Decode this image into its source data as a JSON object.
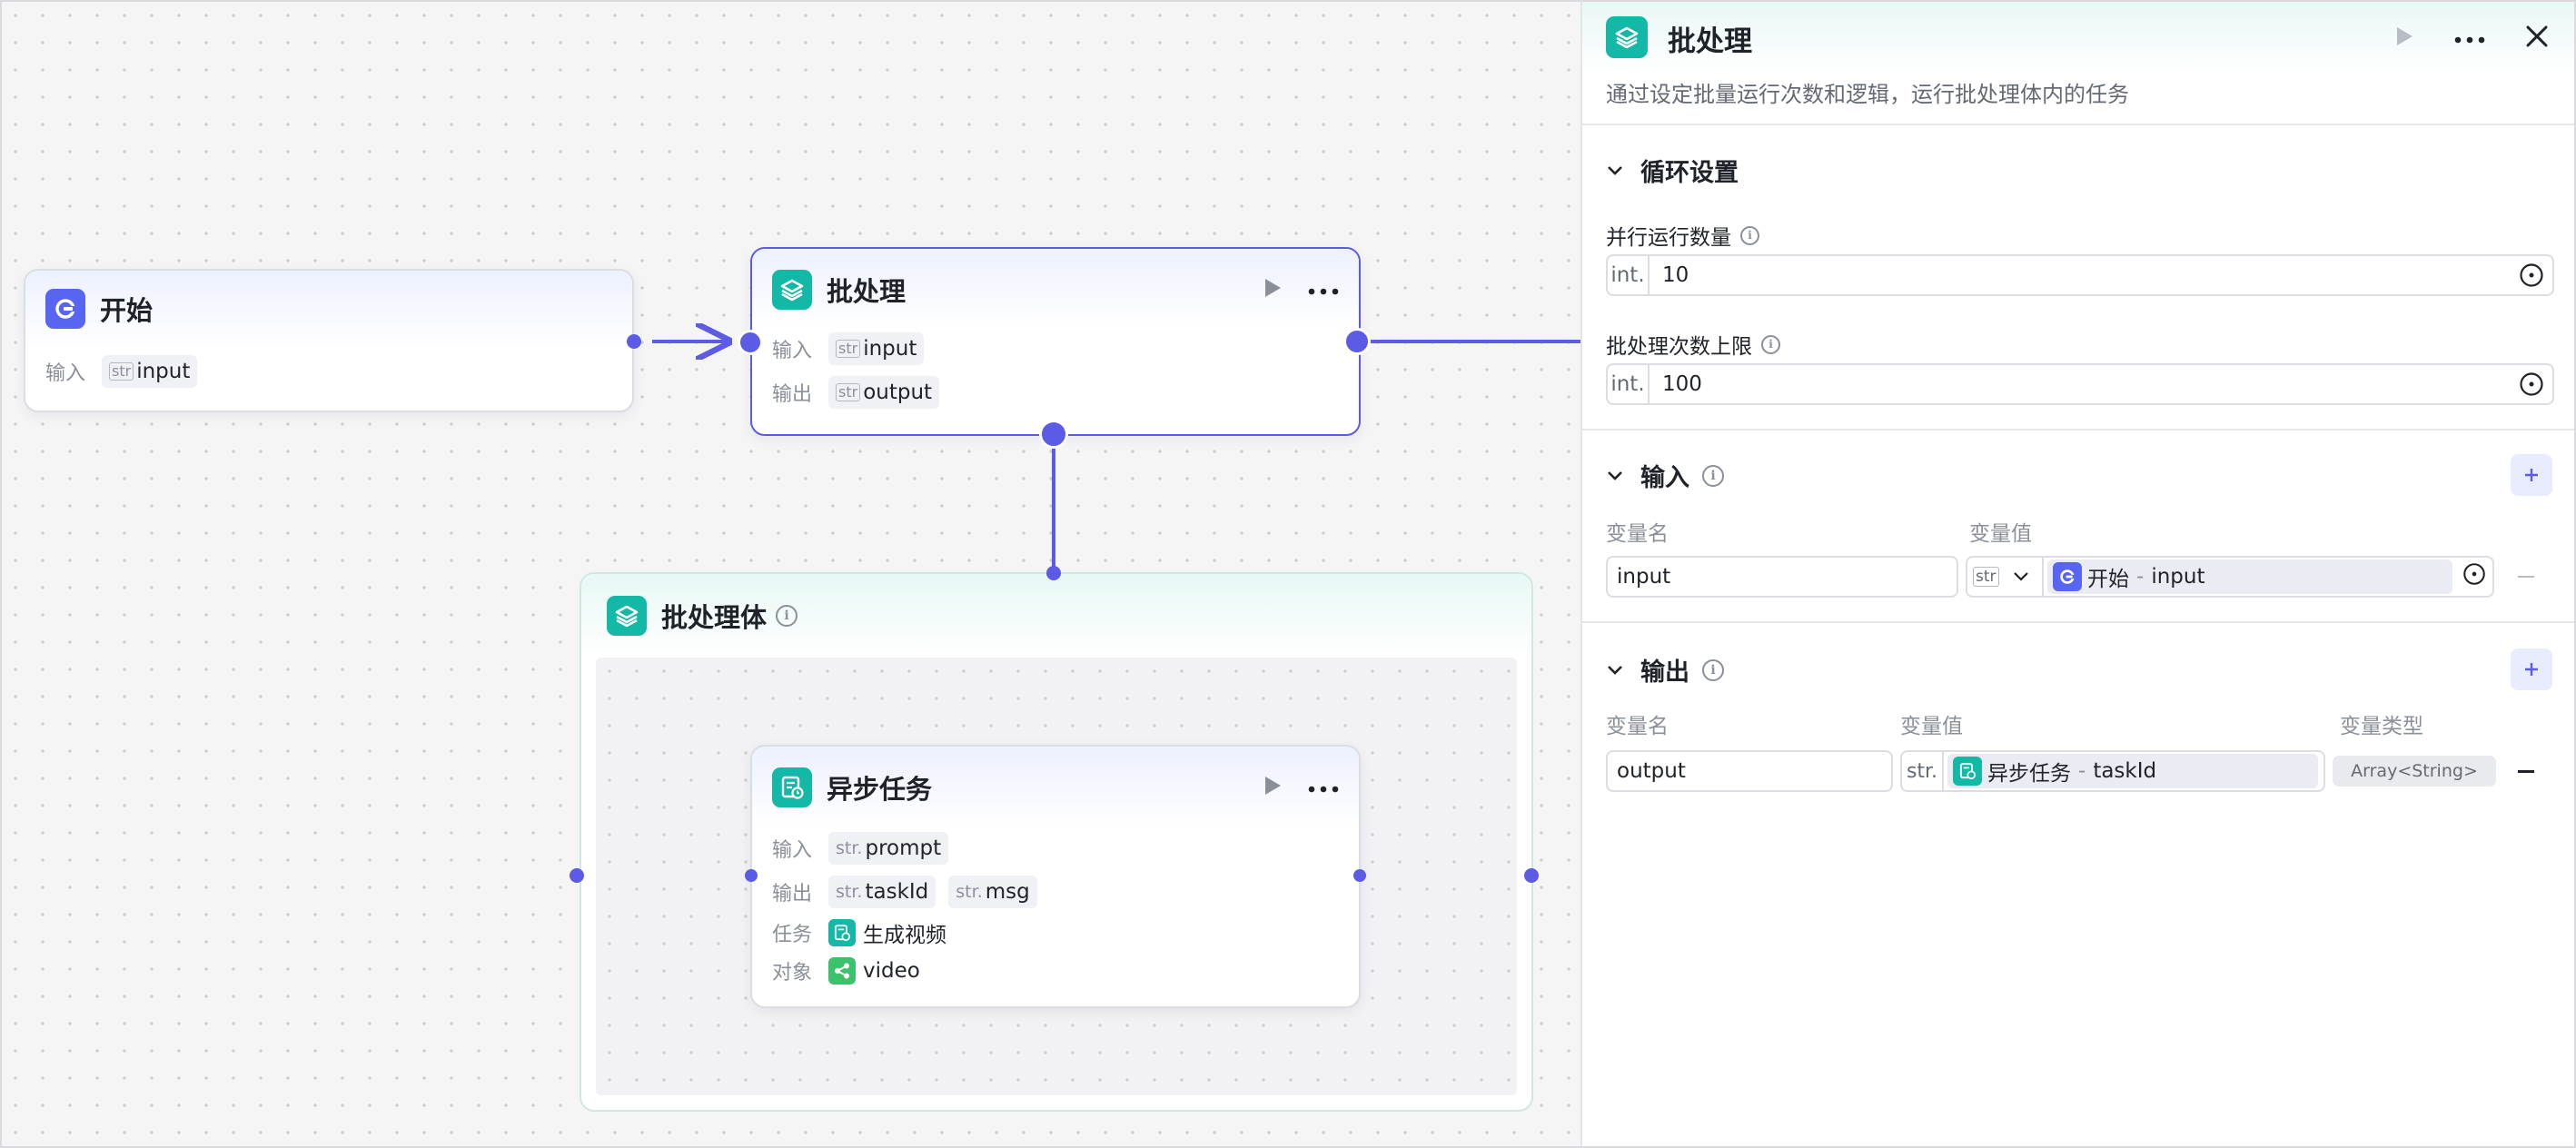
{
  "canvas": {
    "start_node": {
      "title": "开始",
      "input_label": "输入",
      "input_type": "str",
      "input_name": "input"
    },
    "batch_node": {
      "title": "批处理",
      "input_label": "输入",
      "input_type": "str",
      "input_name": "input",
      "output_label": "输出",
      "output_type": "str",
      "output_name": "output"
    },
    "batch_body": {
      "title": "批处理体"
    },
    "async_node": {
      "title": "异步任务",
      "input_label": "输入",
      "input_type": "str.",
      "input_name": "prompt",
      "output_label": "输出",
      "outputs": [
        {
          "type": "str.",
          "name": "taskId"
        },
        {
          "type": "str.",
          "name": "msg"
        }
      ],
      "task_label": "任务",
      "task_value": "生成视频",
      "object_label": "对象",
      "object_value": "video"
    }
  },
  "panel": {
    "title": "批处理",
    "description": "通过设定批量运行次数和逻辑，运行批处理体内的任务",
    "loop_section": {
      "title": "循环设置",
      "parallel_label": "并行运行数量",
      "parallel_prefix": "int.",
      "parallel_value": "10",
      "limit_label": "批处理次数上限",
      "limit_prefix": "int.",
      "limit_value": "100"
    },
    "input_section": {
      "title": "输入",
      "col_name": "变量名",
      "col_value": "变量值",
      "var_name": "input",
      "var_type": "str",
      "ref_node": "开始",
      "ref_sep": "-",
      "ref_var": "input"
    },
    "output_section": {
      "title": "输出",
      "col_name": "变量名",
      "col_value": "变量值",
      "col_type": "变量类型",
      "var_name": "output",
      "var_type_prefix": "str.",
      "ref_node": "异步任务",
      "ref_sep": "-",
      "ref_var": "taskId",
      "type_badge": "Array<String>"
    }
  },
  "colors": {
    "accent": "#5b5be6",
    "teal": "#14b8a6",
    "blue_icon": "#5865f2",
    "green_icon": "#3cc26a"
  }
}
